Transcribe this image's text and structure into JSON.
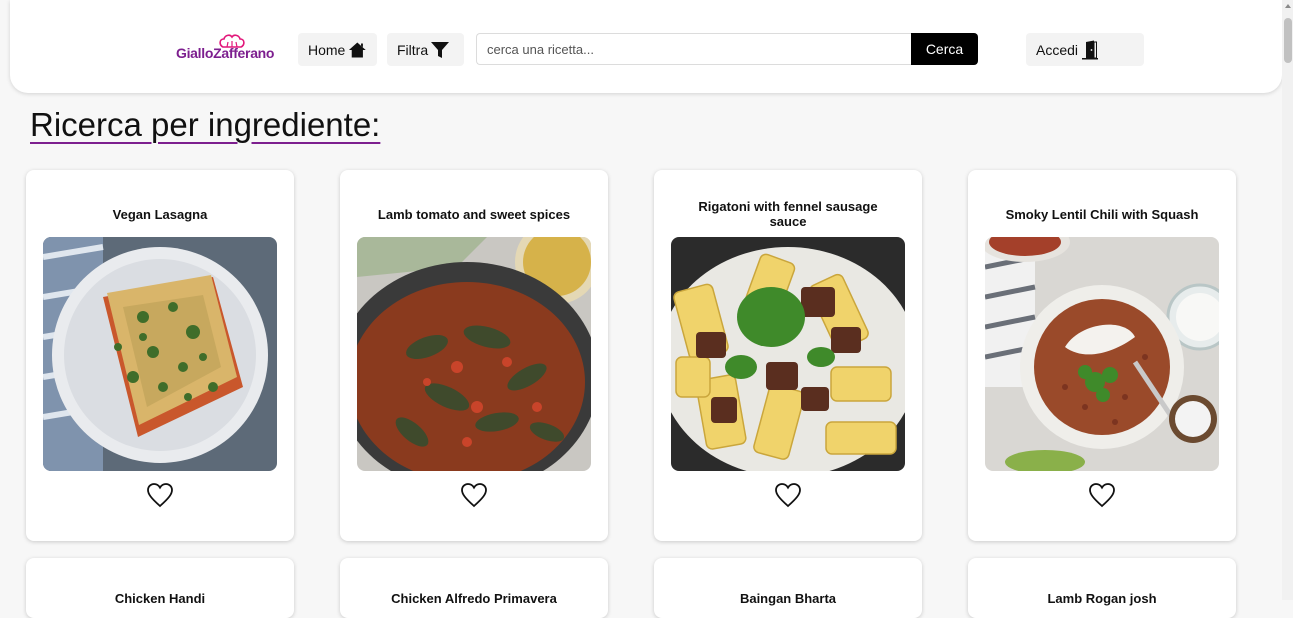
{
  "header": {
    "logo_text": "GialloZafferano",
    "home_label": "Home",
    "filter_label": "Filtra",
    "search_placeholder": "cerca una ricetta...",
    "search_button": "Cerca",
    "login_label": "Accedi"
  },
  "page_title": "Ricerca per ingrediente:",
  "recipes": [
    {
      "title": "Vegan Lasagna",
      "icon": "heart-outline-icon"
    },
    {
      "title": "Lamb tomato and sweet spices",
      "icon": "heart-outline-icon"
    },
    {
      "title": "Rigatoni with fennel sausage sauce",
      "icon": "heart-outline-icon"
    },
    {
      "title": "Smoky Lentil Chili with Squash",
      "icon": "heart-outline-icon"
    },
    {
      "title": "Chicken Handi"
    },
    {
      "title": "Chicken Alfredo Primavera"
    },
    {
      "title": "Baingan Bharta"
    },
    {
      "title": "Lamb Rogan josh"
    }
  ],
  "colors": {
    "brand": "#7d1f8f",
    "search_button": "#000000"
  }
}
